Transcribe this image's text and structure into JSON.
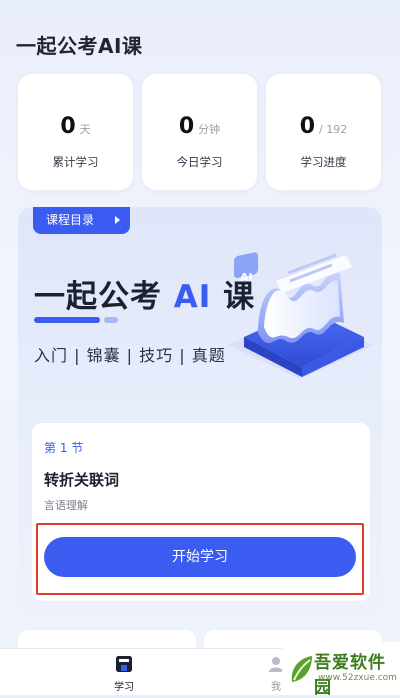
{
  "app": {
    "title": "一起公考AI课"
  },
  "stats": [
    {
      "value": "0",
      "unit": "天",
      "label": "累计学习"
    },
    {
      "value": "0",
      "unit": "分钟",
      "label": "今日学习"
    },
    {
      "value": "0",
      "unit": "/ 192",
      "label": "学习进度"
    }
  ],
  "course": {
    "catalog_label": "课程目录",
    "hero_title_a": "一起公考 ",
    "hero_title_ai": "AI",
    "hero_title_b": " 课",
    "hero_subtitle": "入门 | 锦囊 | 技巧 | 真题",
    "illustration_badge": "AI"
  },
  "lesson": {
    "number": "第 1 节",
    "name": "转折关联词",
    "category": "言语理解",
    "start_label": "开始学习"
  },
  "nav": {
    "study_label": "学习",
    "mine_label": "我"
  },
  "watermark": {
    "name": "吾爱软件园",
    "url": "www.52zxue.com"
  },
  "colors": {
    "accent": "#3b5cf0",
    "highlight_border": "#e23a2e"
  }
}
